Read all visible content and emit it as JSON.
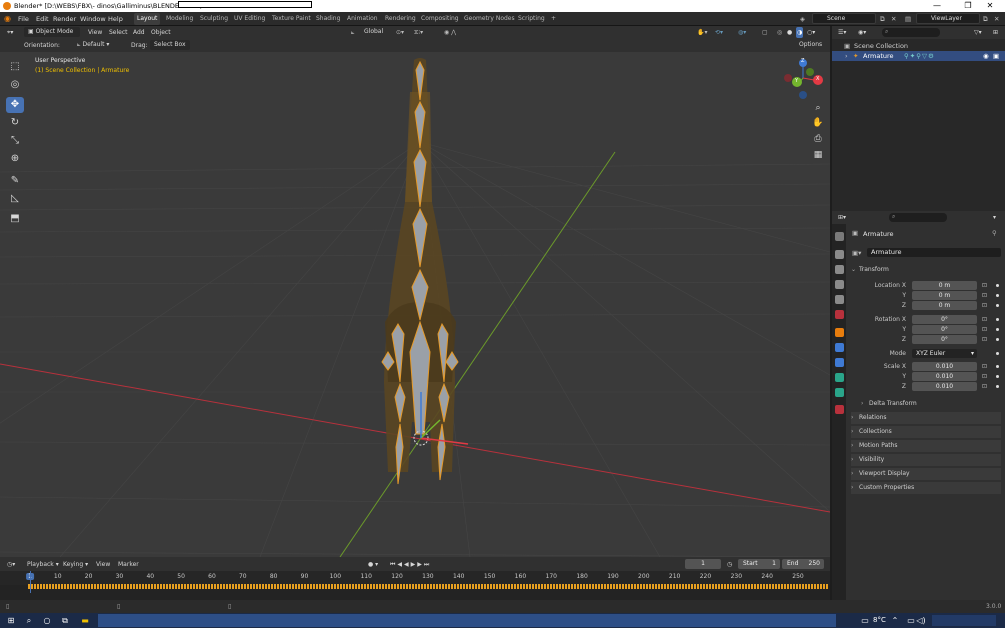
{
  "window": {
    "title": "Blender* [D:\\WEBS\\FBX\\- dinos\\Galliminus\\BLENDER FILE\\B",
    "minimize": "—",
    "maximize": "❐",
    "close": "✕"
  },
  "menu": {
    "items": [
      "File",
      "Edit",
      "Render",
      "Window",
      "Help"
    ]
  },
  "workspaces": [
    "Layout",
    "Modeling",
    "Sculpting",
    "UV Editing",
    "Texture Paint",
    "Shading",
    "Animation",
    "Rendering",
    "Compositing",
    "Geometry Nodes",
    "Scripting",
    "+"
  ],
  "scene": {
    "label": "Scene",
    "view_layer": "ViewLayer"
  },
  "viewport_header": {
    "mode": "Object Mode",
    "menus": [
      "View",
      "Select",
      "Add",
      "Object"
    ],
    "transform": "Global",
    "orientation_label": "Orientation:",
    "orientation_value": "Default",
    "drag_label": "Drag:",
    "drag_value": "Select Box",
    "options": "Options"
  },
  "viewport": {
    "perspective": "User Perspective",
    "collection": "(1) Scene Collection | Armature",
    "gizmo": {
      "z": "Z",
      "y": "Y",
      "x": "X"
    }
  },
  "outliner": {
    "root": "Scene Collection",
    "item": "Armature"
  },
  "properties": {
    "object_name": "Armature",
    "data_name": "Armature",
    "transform_header": "Transform",
    "location_label": "Location X",
    "location": [
      "0 m",
      "0 m",
      "0 m"
    ],
    "rotation_label": "Rotation X",
    "rotation": [
      "0°",
      "0°",
      "0°"
    ],
    "mode_label": "Mode",
    "mode_value": "XYZ Euler",
    "scale_label": "Scale X",
    "scale": [
      "0.010",
      "0.010",
      "0.010"
    ],
    "axis_y": "Y",
    "axis_z": "Z",
    "panels": [
      "Delta Transform",
      "Relations",
      "Collections",
      "Motion Paths",
      "Visibility",
      "Viewport Display",
      "Custom Properties"
    ]
  },
  "timeline": {
    "menus": [
      "Playback",
      "Keying",
      "View",
      "Marker"
    ],
    "current_frame": "1",
    "start_label": "Start",
    "start": "1",
    "end_label": "End",
    "end": "250",
    "ticks": [
      "1",
      "10",
      "20",
      "30",
      "40",
      "50",
      "60",
      "70",
      "80",
      "90",
      "100",
      "110",
      "120",
      "130",
      "140",
      "150",
      "160",
      "170",
      "180",
      "190",
      "200",
      "210",
      "220",
      "230",
      "240",
      "250"
    ]
  },
  "status": {
    "version": "3.0.0"
  },
  "taskbar": {
    "temperature": "8°C"
  }
}
